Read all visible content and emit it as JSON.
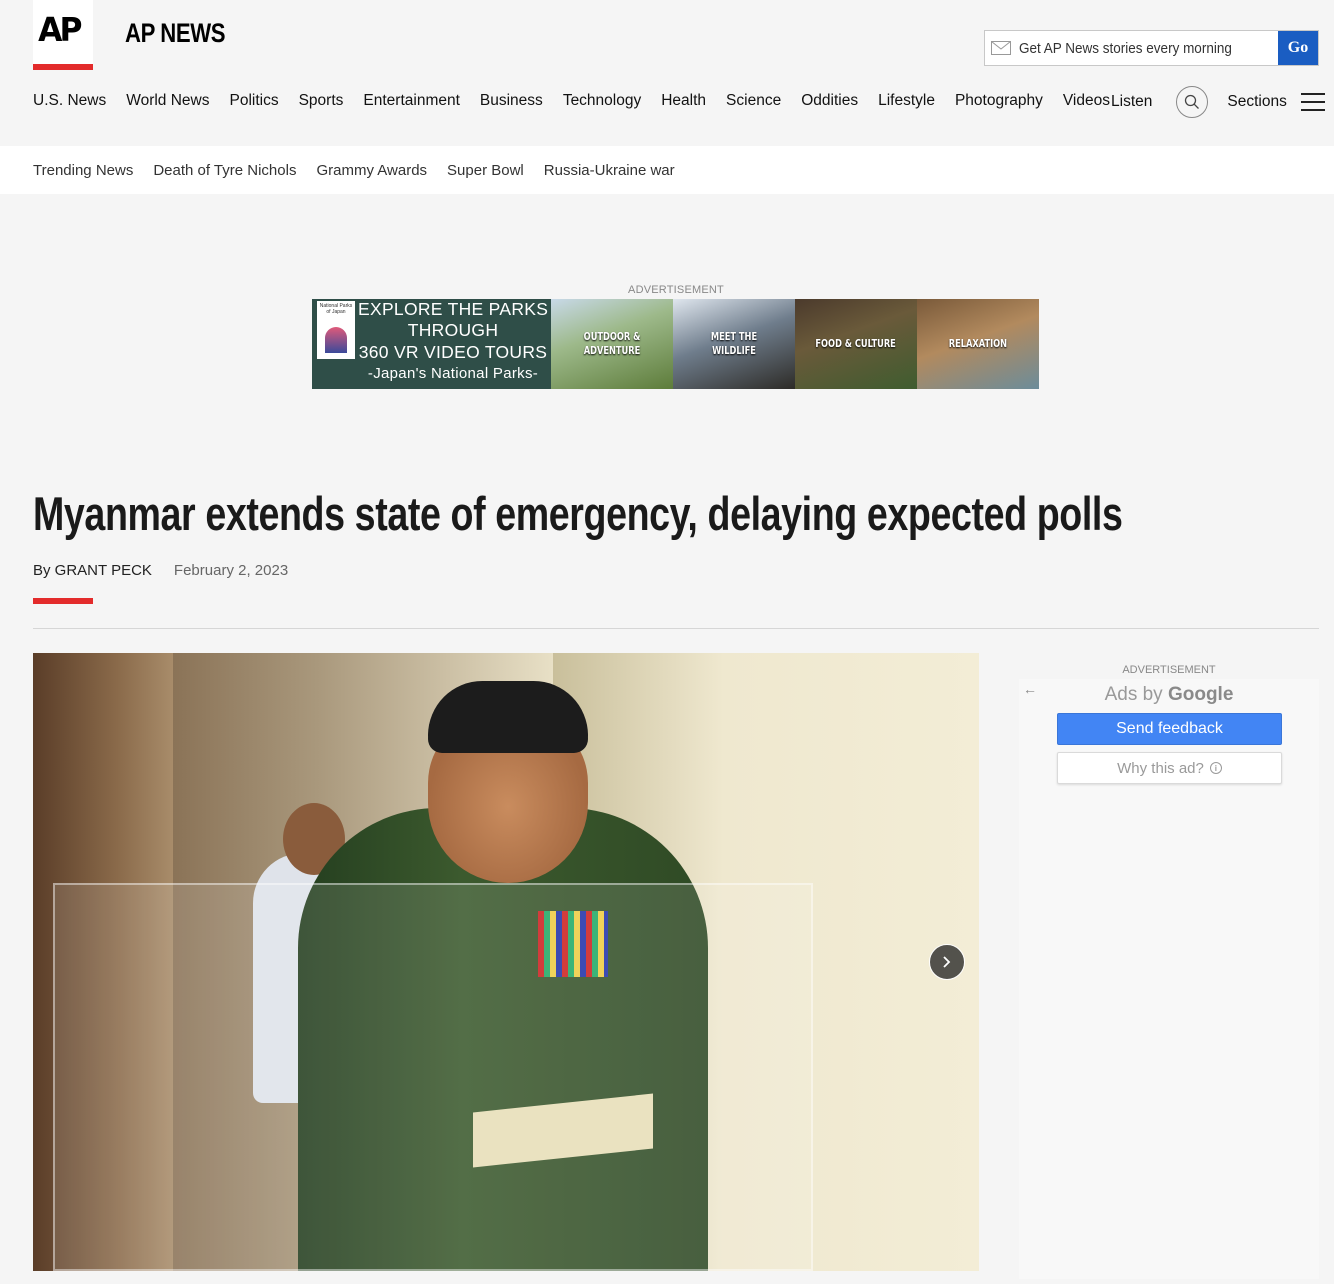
{
  "header": {
    "logo_text": "AP",
    "site_name": "AP NEWS",
    "newsletter": {
      "placeholder": "Get AP News stories every morning",
      "go_label": "Go"
    },
    "nav": [
      "U.S. News",
      "World News",
      "Politics",
      "Sports",
      "Entertainment",
      "Business",
      "Technology",
      "Health",
      "Science",
      "Oddities",
      "Lifestyle",
      "Photography",
      "Videos"
    ],
    "listen_label": "Listen",
    "sections_label": "Sections",
    "icons": {
      "search": "search-icon",
      "menu": "hamburger-icon",
      "email": "envelope-icon"
    }
  },
  "trending": [
    "Trending News",
    "Death of Tyre Nichols",
    "Grammy Awards",
    "Super Bowl",
    "Russia-Ukraine war"
  ],
  "top_ad": {
    "label": "ADVERTISEMENT",
    "logo_text": "National Parks of Japan",
    "lines": [
      "EXPLORE THE PARKS",
      "THROUGH",
      "360 VR VIDEO TOURS",
      "-Japan's National Parks-"
    ],
    "tiles": [
      "OUTDOOR & ADVENTURE",
      "MEET THE WILDLIFE",
      "FOOD & CULTURE",
      "RELAXATION"
    ]
  },
  "article": {
    "headline": "Myanmar extends state of emergency, delaying expected polls",
    "byline": "By GRANT PECK",
    "date": "February 2, 2023"
  },
  "side_ad": {
    "label": "ADVERTISEMENT",
    "ads_by": "Ads by",
    "google": "Google",
    "send_feedback": "Send feedback",
    "why_this_ad": "Why this ad?"
  },
  "colors": {
    "accent_red": "#e32b2b",
    "go_blue": "#1a5dc2",
    "feedback_blue": "#4285f4"
  }
}
